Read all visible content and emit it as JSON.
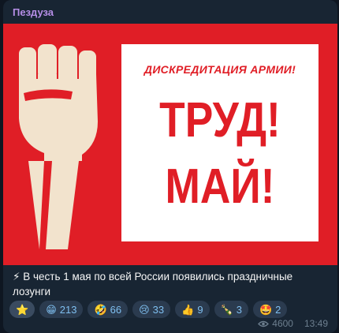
{
  "channel": {
    "name": "Пездуза"
  },
  "poster": {
    "top_line": "ДИСКРЕДИТАЦИЯ АРМИИ!",
    "line1": "ТРУД!",
    "line2": "МАЙ!"
  },
  "message": {
    "text": "⚡ В честь 1 мая по всей России появились праздничные лозунги",
    "views": "4600",
    "time": "13:49"
  },
  "reactions": [
    {
      "emoji": "⭐",
      "count": ""
    },
    {
      "emoji": "😁",
      "count": "213"
    },
    {
      "emoji": "🤣",
      "count": "66"
    },
    {
      "emoji": "😢",
      "count": "33"
    },
    {
      "emoji": "👍",
      "count": "9"
    },
    {
      "emoji": "🍾",
      "count": "3"
    },
    {
      "emoji": "🤩",
      "count": "2"
    }
  ],
  "colors": {
    "bubble": "#182533",
    "poster_red": "#e01e26",
    "sender": "#b58ee6",
    "reaction_count": "#7fbff0"
  },
  "icons": {
    "views": "eye-icon"
  }
}
